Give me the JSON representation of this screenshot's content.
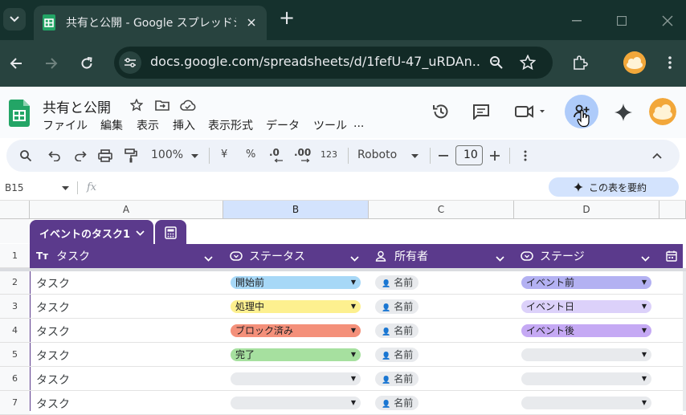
{
  "browser": {
    "tab_title": "共有と公開 - Google スプレッドシ",
    "url": "docs.google.com/spreadsheets/d/1fefU-47_uRDAn...",
    "new_tab": "+"
  },
  "doc": {
    "title": "共有と公開",
    "menu": [
      "ファイル",
      "編集",
      "表示",
      "挿入",
      "表示形式",
      "データ",
      "ツール",
      "..."
    ]
  },
  "toolbar": {
    "zoom": "100%",
    "currency": "¥",
    "percent": "%",
    "dec_decrease": ".0",
    "dec_increase": ".00",
    "number_format": "123",
    "font": "Roboto",
    "font_size": "10"
  },
  "formula": {
    "name_box": "B15",
    "fx": "fx",
    "summarize_button": "この表を要約"
  },
  "columns": [
    "A",
    "B",
    "C",
    "D"
  ],
  "table": {
    "name": "イベントのタスク1",
    "headers": {
      "a": "タスク",
      "b": "ステータス",
      "c": "所有者",
      "d": "ステージ",
      "a_icon_text": "Tт"
    },
    "rows": [
      {
        "num": "1"
      },
      {
        "num": "2",
        "task": "タスク",
        "status": "開始前",
        "owner": "名前",
        "stage": "イベント前"
      },
      {
        "num": "3",
        "task": "タスク",
        "status": "処理中",
        "owner": "名前",
        "stage": "イベント日"
      },
      {
        "num": "4",
        "task": "タスク",
        "status": "ブロック済み",
        "owner": "名前",
        "stage": "イベント後"
      },
      {
        "num": "5",
        "task": "タスク",
        "status": "完了",
        "owner": "名前",
        "stage": ""
      },
      {
        "num": "6",
        "task": "タスク",
        "status": "",
        "owner": "名前",
        "stage": ""
      },
      {
        "num": "7",
        "task": "タスク",
        "status": "",
        "owner": "名前",
        "stage": ""
      }
    ]
  },
  "colors": {
    "table_header": "#5b3a8c",
    "status_not_started": "#a7d8f7",
    "status_in_progress": "#fdf08f",
    "status_blocked": "#f4907a",
    "status_done": "#a6e09f",
    "stage_pre": "#b3b1f2",
    "stage_day": "#dcd1fa",
    "stage_post": "#c5a9f4",
    "empty_chip": "#e8eaed"
  }
}
